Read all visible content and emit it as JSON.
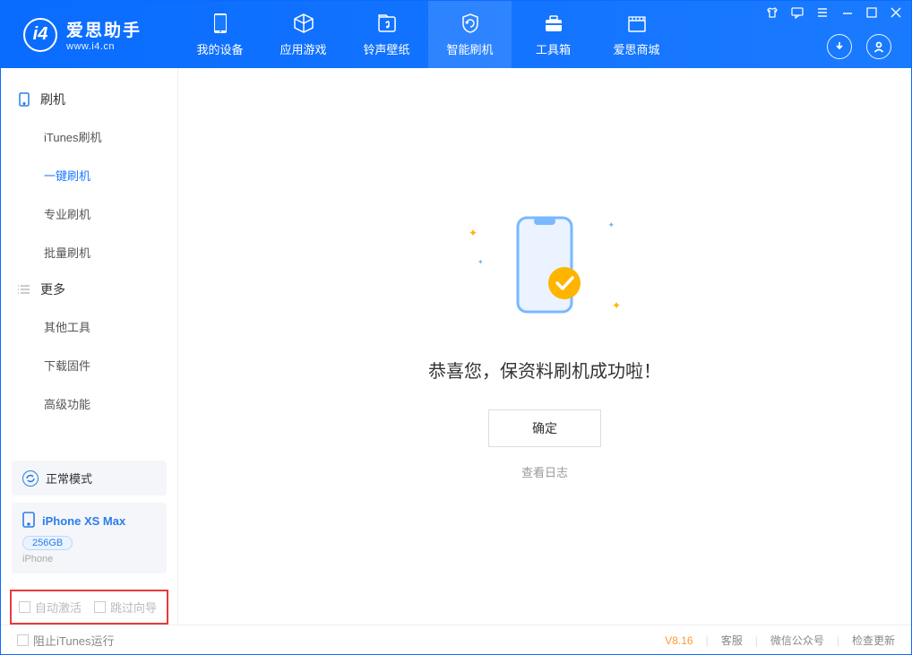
{
  "app": {
    "title": "爱思助手",
    "url": "www.i4.cn"
  },
  "nav": {
    "tabs": [
      {
        "label": "我的设备"
      },
      {
        "label": "应用游戏"
      },
      {
        "label": "铃声壁纸"
      },
      {
        "label": "智能刷机"
      },
      {
        "label": "工具箱"
      },
      {
        "label": "爱思商城"
      }
    ]
  },
  "sidebar": {
    "section1": {
      "title": "刷机",
      "items": [
        {
          "label": "iTunes刷机"
        },
        {
          "label": "一键刷机"
        },
        {
          "label": "专业刷机"
        },
        {
          "label": "批量刷机"
        }
      ]
    },
    "section2": {
      "title": "更多",
      "items": [
        {
          "label": "其他工具"
        },
        {
          "label": "下载固件"
        },
        {
          "label": "高级功能"
        }
      ]
    },
    "mode_card": {
      "label": "正常模式"
    },
    "device_card": {
      "name": "iPhone XS Max",
      "storage": "256GB",
      "type": "iPhone"
    },
    "checks": {
      "auto_activate": "自动激活",
      "skip_guide": "跳过向导"
    }
  },
  "main": {
    "success_msg": "恭喜您，保资料刷机成功啦！",
    "ok_btn": "确定",
    "log_link": "查看日志"
  },
  "footer": {
    "block_itunes": "阻止iTunes运行",
    "version": "V8.16",
    "links": {
      "support": "客服",
      "wechat": "微信公众号",
      "update": "检查更新"
    }
  }
}
